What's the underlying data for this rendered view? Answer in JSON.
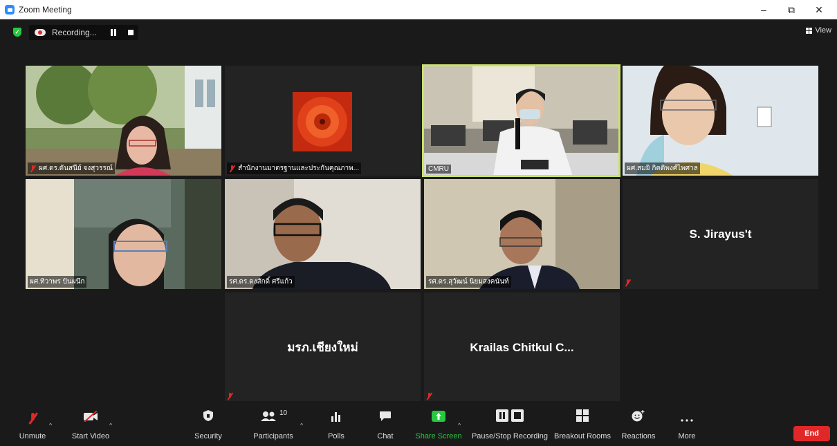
{
  "window": {
    "title": "Zoom Meeting",
    "minimize": "–",
    "restore": "⧉",
    "close": "✕"
  },
  "recording": {
    "label": "Recording..."
  },
  "view": {
    "label": "View"
  },
  "participants": [
    {
      "name": "ผศ.ดร.ดันสนีย์ จงสุวรรณ์",
      "muted": true,
      "active": false,
      "scene": "outdoor-woman"
    },
    {
      "name": "สำนักงานมาตรฐานและประกันคุณภาพ...",
      "muted": true,
      "active": false,
      "scene": "flower"
    },
    {
      "name": "CMRU",
      "muted": false,
      "active": true,
      "scene": "classroom"
    },
    {
      "name": "ผศ.สมยิ กิตติพงศ์ไพศาล",
      "muted": false,
      "active": false,
      "scene": "woman-glasses"
    },
    {
      "name": "ผศ.ทิวาพร ปันผนึก",
      "muted": false,
      "active": false,
      "scene": "woman-room"
    },
    {
      "name": "รศ.ดร.ดงสักดิ์ ศรีแก้ว",
      "muted": false,
      "active": false,
      "scene": "man-glasses"
    },
    {
      "name": "รศ.ดร.สุวัฒน์ นิยมสงคนันท์",
      "muted": false,
      "active": false,
      "scene": "man-suit"
    },
    {
      "name": "S. Jirayus't",
      "muted": true,
      "active": false,
      "scene": "name-only"
    },
    {
      "name": "มรภ.เชียงใหม่",
      "muted": true,
      "active": false,
      "scene": "name-only"
    },
    {
      "name": "Krailas Chitkul C...",
      "muted": true,
      "active": false,
      "scene": "name-only"
    }
  ],
  "toolbar": {
    "unmute": "Unmute",
    "start_video": "Start Video",
    "security": "Security",
    "participants": "Participants",
    "participants_count": "10",
    "polls": "Polls",
    "chat": "Chat",
    "share_screen": "Share Screen",
    "pause_stop_recording": "Pause/Stop Recording",
    "breakout_rooms": "Breakout Rooms",
    "reactions": "Reactions",
    "more": "More",
    "end": "End"
  },
  "colors": {
    "active_border": "#c9e26b",
    "share_green": "#28c840",
    "end_red": "#e02828",
    "muted_red": "#e02828"
  }
}
